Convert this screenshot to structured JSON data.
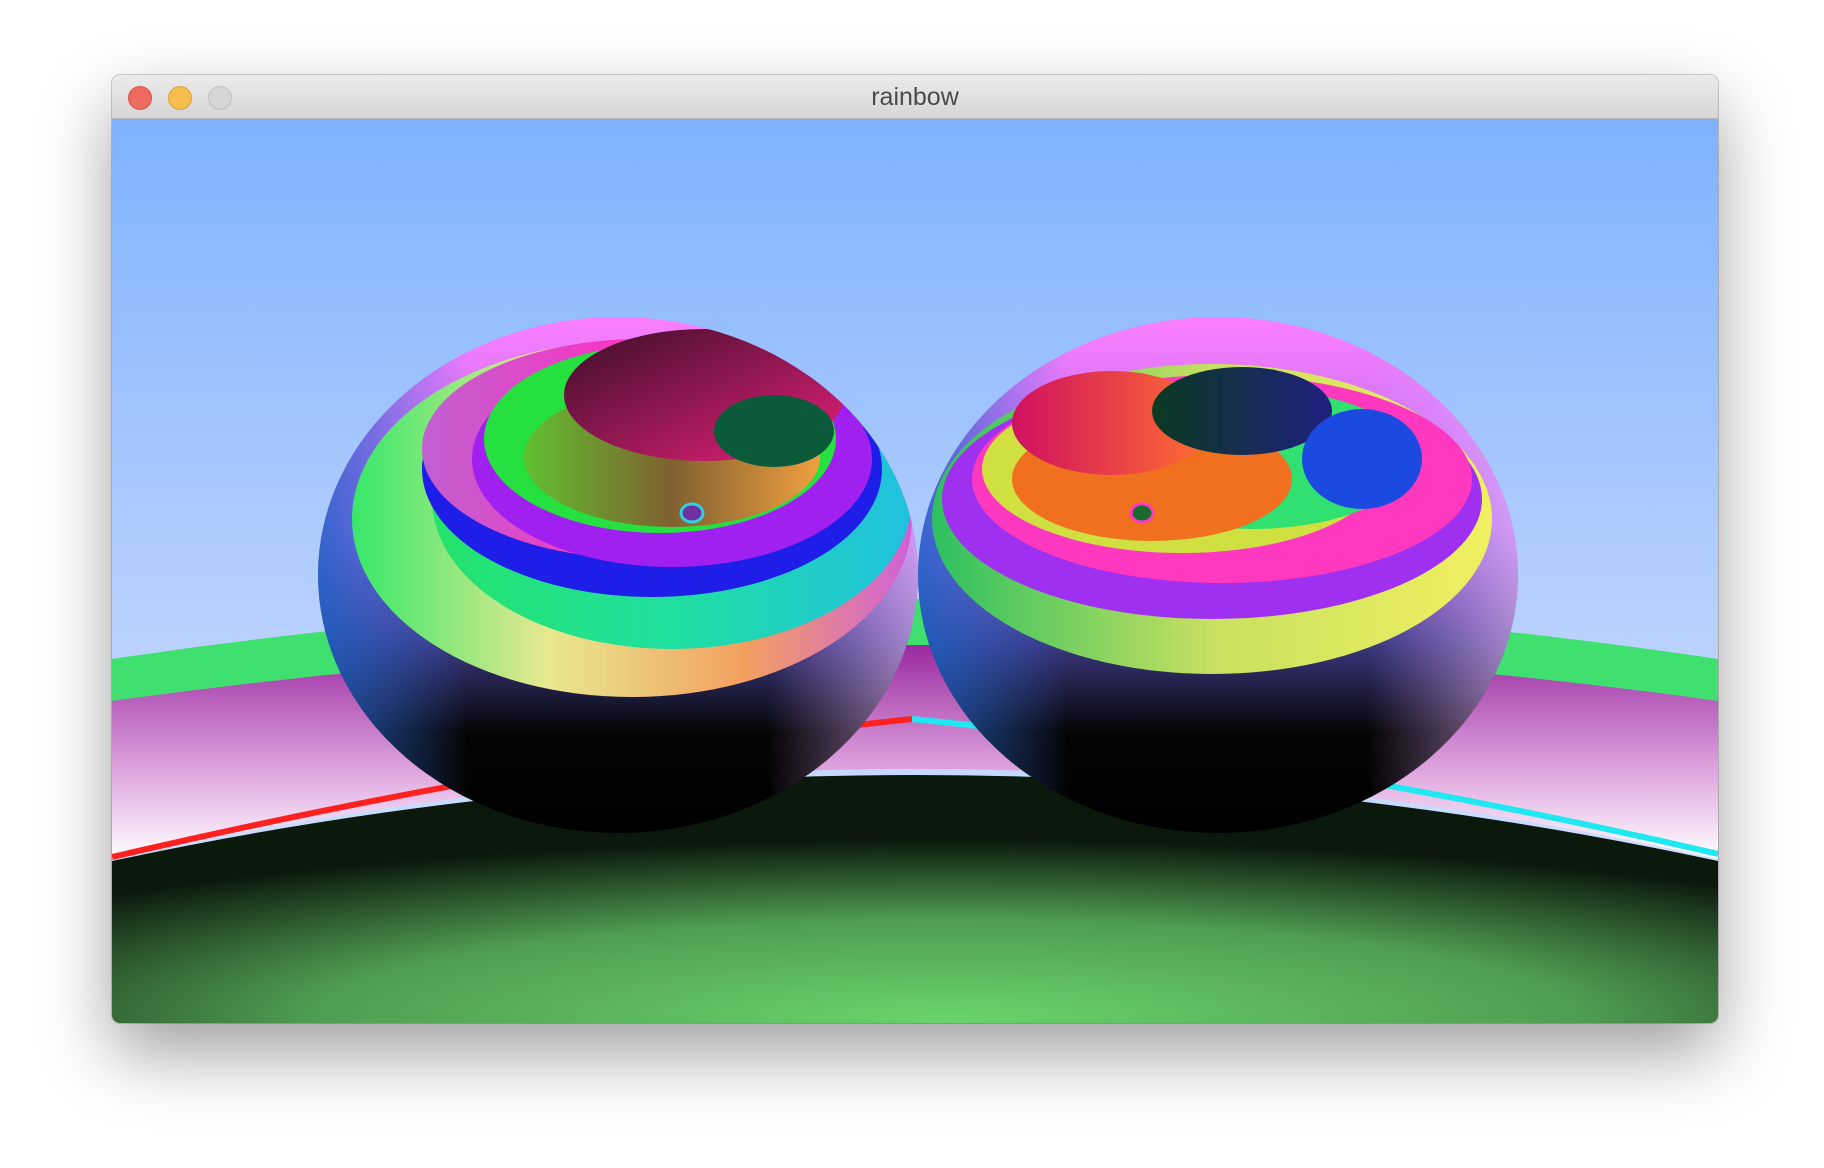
{
  "window": {
    "title": "rainbow"
  },
  "render": {
    "sky_top_color": "#7fb2fe",
    "sky_bottom_color": "#d9e7ff",
    "ground_color": "#68d16b",
    "sphere_style": "rainbow banded normal shading",
    "sphere_count": 2
  },
  "icons": {
    "close": "close-icon",
    "minimize": "minimize-icon",
    "zoom": "zoom-icon"
  }
}
